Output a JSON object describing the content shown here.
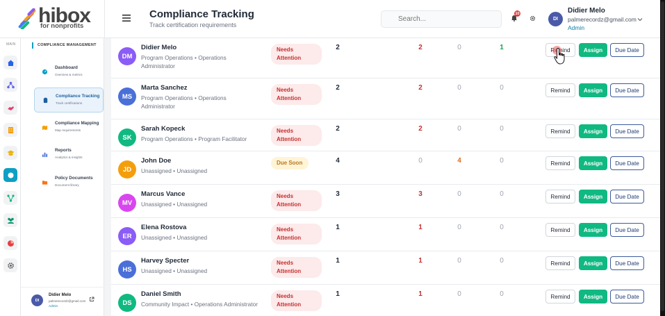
{
  "brand": {
    "name": "hibox",
    "tagline": "for nonprofits"
  },
  "header": {
    "title": "Compliance Tracking",
    "subtitle": "Track certification requirements",
    "search_placeholder": "Search...",
    "notification_count": "10",
    "user": {
      "initials": "DI",
      "name": "Didier Melo",
      "email": "palmerecordz@gmail.com",
      "role": "Admin"
    }
  },
  "rail": {
    "label": "MAIN",
    "icons": [
      "home-icon",
      "org-icon",
      "handshake-icon",
      "building-icon",
      "graduation-icon",
      "compliance-icon",
      "network-icon",
      "team-icon",
      "pie-chart-icon",
      "settings-icon"
    ]
  },
  "sidebar": {
    "section_title": "COMPLIANCE MANAGEMENT",
    "items": [
      {
        "label": "Dashboard",
        "sub": "Overview & metrics"
      },
      {
        "label": "Compliance Tracking",
        "sub": "Track certifications"
      },
      {
        "label": "Compliance Mapping",
        "sub": "Map requirements"
      },
      {
        "label": "Reports",
        "sub": "Analytics & insights"
      },
      {
        "label": "Policy Documents",
        "sub": "Document library"
      }
    ],
    "user": {
      "initials": "DI",
      "name": "Didier Melo",
      "email": "palmerecordz@gmail.com",
      "role": "Admin"
    }
  },
  "actions": {
    "remind": "Remind",
    "assign": "Assign",
    "due_date": "Due Date"
  },
  "rows": [
    {
      "initials": "DM",
      "color": "#8b5cf6",
      "name": "Didier Melo",
      "role": "Program Operations • Operations Administrator",
      "status": "Needs Attention",
      "c1": "2",
      "c2": "2",
      "c3": "0",
      "c4": "1"
    },
    {
      "initials": "MS",
      "color": "#4a6fd8",
      "name": "Marta Sanchez",
      "role": "Program Operations • Operations Administrator",
      "status": "Needs Attention",
      "c1": "2",
      "c2": "2",
      "c3": "0",
      "c4": "0"
    },
    {
      "initials": "SK",
      "color": "#10b981",
      "name": "Sarah Kopeck",
      "role": "Program Operations • Program Facilitator",
      "status": "Needs Attention",
      "c1": "2",
      "c2": "2",
      "c3": "0",
      "c4": "0"
    },
    {
      "initials": "JD",
      "color": "#f59e0b",
      "name": "John Doe",
      "role": "Unassigned • Unassigned",
      "status": "Due Soon",
      "c1": "4",
      "c2": "0",
      "c3": "4",
      "c4": "0"
    },
    {
      "initials": "MV",
      "color": "#d946ef",
      "name": "Marcus Vance",
      "role": "Unassigned • Unassigned",
      "status": "Needs Attention",
      "c1": "3",
      "c2": "3",
      "c3": "0",
      "c4": "0"
    },
    {
      "initials": "ER",
      "color": "#8b5cf6",
      "name": "Elena Rostova",
      "role": "Unassigned • Unassigned",
      "status": "Needs Attention",
      "c1": "1",
      "c2": "1",
      "c3": "0",
      "c4": "0"
    },
    {
      "initials": "HS",
      "color": "#4a6fd8",
      "name": "Harvey Specter",
      "role": "Unassigned • Unassigned",
      "status": "Needs Attention",
      "c1": "1",
      "c2": "1",
      "c3": "0",
      "c4": "0"
    },
    {
      "initials": "DS",
      "color": "#10b981",
      "name": "Daniel Smith",
      "role": "Community Impact • Operations Administrator",
      "status": "Needs Attention",
      "c1": "1",
      "c2": "1",
      "c3": "0",
      "c4": "0"
    }
  ]
}
